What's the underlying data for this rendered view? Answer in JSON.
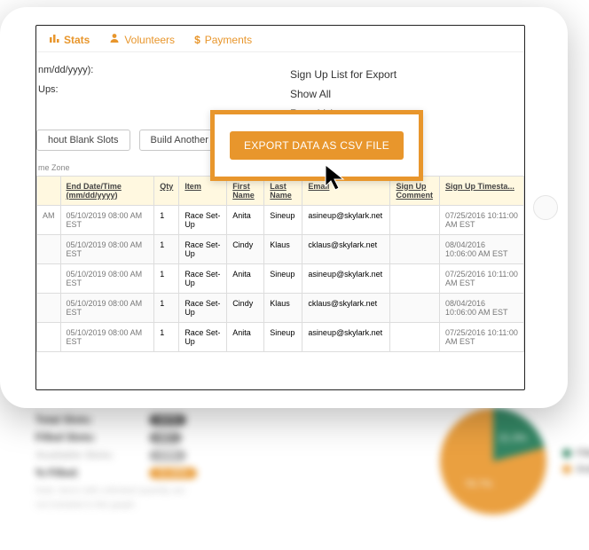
{
  "tabs": {
    "stats": "Stats",
    "volunteers": "Volunteers",
    "payments": "Payments"
  },
  "upper_left": {
    "date_format_hint": "nm/dd/yyyy):",
    "ups_label": "Ups:"
  },
  "upper_right": {
    "line1": "Sign Up List for Export",
    "line2": "Show All",
    "line3": "Race Volunteers"
  },
  "actions": {
    "blank_slots": "hout Blank Slots",
    "build_another": "Build Another Report",
    "export_csv": "EXPORT DATA AS CSV FILE"
  },
  "zone_note": "me Zone",
  "table": {
    "headers": {
      "prefix": "",
      "end": "End Date/Time (mm/dd/yyyy)",
      "qty": "Qty",
      "item": "Item",
      "first": "First Name",
      "last": "Last Name",
      "email": "Email",
      "comment": "Sign Up Comment",
      "ts": "Sign Up Timesta..."
    },
    "rows": [
      {
        "prefix": "AM",
        "end": "05/10/2019 08:00 AM EST",
        "qty": "1",
        "item": "Race Set-Up",
        "first": "Anita",
        "last": "Sineup",
        "email": "asineup@skylark.net",
        "comment": "",
        "ts": "07/25/2016 10:11:00 AM EST"
      },
      {
        "prefix": "",
        "end": "05/10/2019 08:00 AM EST",
        "qty": "1",
        "item": "Race Set-Up",
        "first": "Cindy",
        "last": "Klaus",
        "email": "cklaus@skylark.net",
        "comment": "",
        "ts": "08/04/2016 10:06:00 AM EST"
      },
      {
        "prefix": "",
        "end": "05/10/2019 08:00 AM EST",
        "qty": "1",
        "item": "Race Set-Up",
        "first": "Anita",
        "last": "Sineup",
        "email": "asineup@skylark.net",
        "comment": "",
        "ts": "07/25/2016 10:11:00 AM EST"
      },
      {
        "prefix": "",
        "end": "05/10/2019 08:00 AM EST",
        "qty": "1",
        "item": "Race Set-Up",
        "first": "Cindy",
        "last": "Klaus",
        "email": "cklaus@skylark.net",
        "comment": "",
        "ts": "08/04/2016 10:06:00 AM EST"
      },
      {
        "prefix": "",
        "end": "05/10/2019 08:00 AM EST",
        "qty": "1",
        "item": "Race Set-Up",
        "first": "Anita",
        "last": "Sineup",
        "email": "asineup@skylark.net",
        "comment": "",
        "ts": "07/25/2016 10:11:00 AM EST"
      }
    ]
  },
  "bg": {
    "total": "Total Slots:",
    "filled": "Filled Slots:",
    "available": "Available Slots:",
    "pct": "% Filled:",
    "pill_total": "2473",
    "pill_filled": "487",
    "pill_available": "1986",
    "pill_pct": "21.30%",
    "note1": "Note: items with unlimited quantity are",
    "note2": "not included in this graph.",
    "pie_filled": "21.3%",
    "pie_available": "78.7%",
    "legend_filled": "Filled",
    "legend_available": "Available"
  }
}
